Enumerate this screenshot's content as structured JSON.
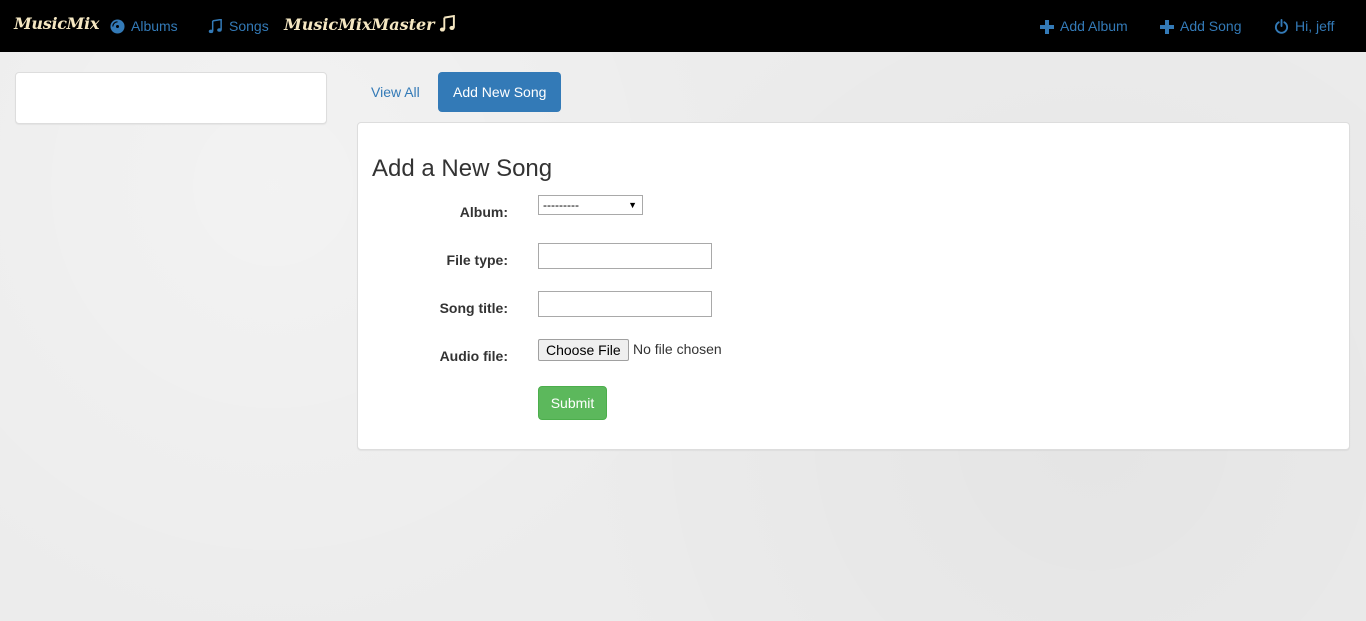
{
  "navbar": {
    "brand": "MusicMix",
    "albums_label": "Albums",
    "songs_label": "Songs",
    "master_title": "MusicMixMaster",
    "add_album_label": "Add Album",
    "add_song_label": "Add Song",
    "user_label": "Hi, jeff",
    "icons": {
      "albums": "disc-icon",
      "songs": "music-note-icon",
      "master": "music-note-icon",
      "add_album": "plus-icon",
      "add_song": "plus-icon",
      "user": "power-icon"
    }
  },
  "tabs": {
    "view_all": "View All",
    "add_new_song": "Add New Song"
  },
  "form": {
    "title": "Add a New Song",
    "album_label": "Album:",
    "album_selected": "---------",
    "file_type_label": "File type:",
    "file_type_value": "",
    "song_title_label": "Song title:",
    "song_title_value": "",
    "audio_file_label": "Audio file:",
    "choose_file_label": "Choose File",
    "file_status": "No file chosen",
    "submit_label": "Submit"
  },
  "colors": {
    "navbar_bg": "#000000",
    "link": "#337ab7",
    "brand": "#f5e7c2",
    "primary": "#337ab7",
    "success": "#5cb85c",
    "page_bg": "#ececec"
  }
}
